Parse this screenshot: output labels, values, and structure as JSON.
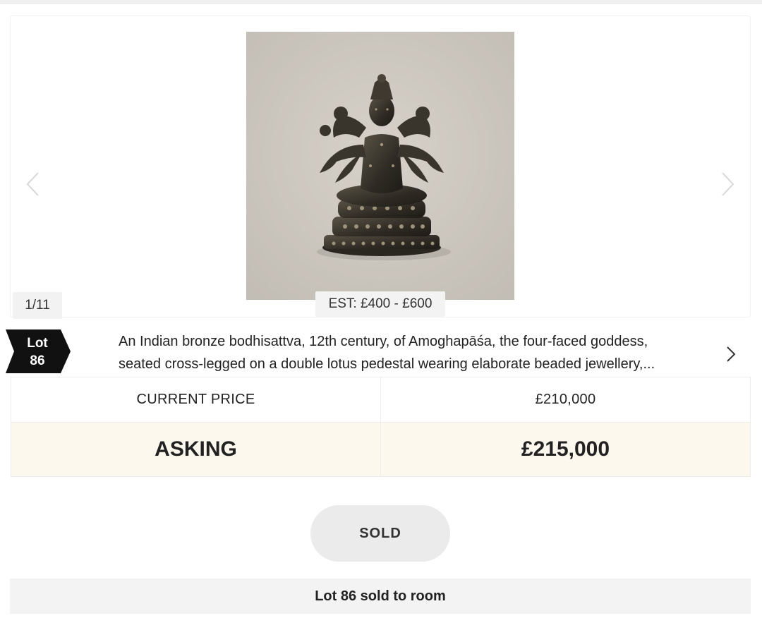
{
  "gallery": {
    "counter": "1/11",
    "estimate": "EST: £400 - £600",
    "prev_icon": "chevron-left-icon",
    "next_icon": "chevron-right-icon"
  },
  "lot": {
    "label": "Lot",
    "number": "86",
    "badge_color": "#111111",
    "description_line1": "An Indian bronze bodhisattva, 12th century, of Amoghapāśa, the four-faced goddess,",
    "description_line2": "seated cross-legged on a double lotus pedestal wearing elaborate beaded jewellery,...",
    "detail_icon": "chevron-right-icon"
  },
  "pricing": {
    "current_label": "CURRENT PRICE",
    "current_value": "£210,000",
    "asking_label": "ASKING",
    "asking_value": "£215,000",
    "asking_row_color": "#fdf8ee"
  },
  "actions": {
    "sold_label": "SOLD"
  },
  "status": {
    "message": "Lot 86 sold to room"
  }
}
